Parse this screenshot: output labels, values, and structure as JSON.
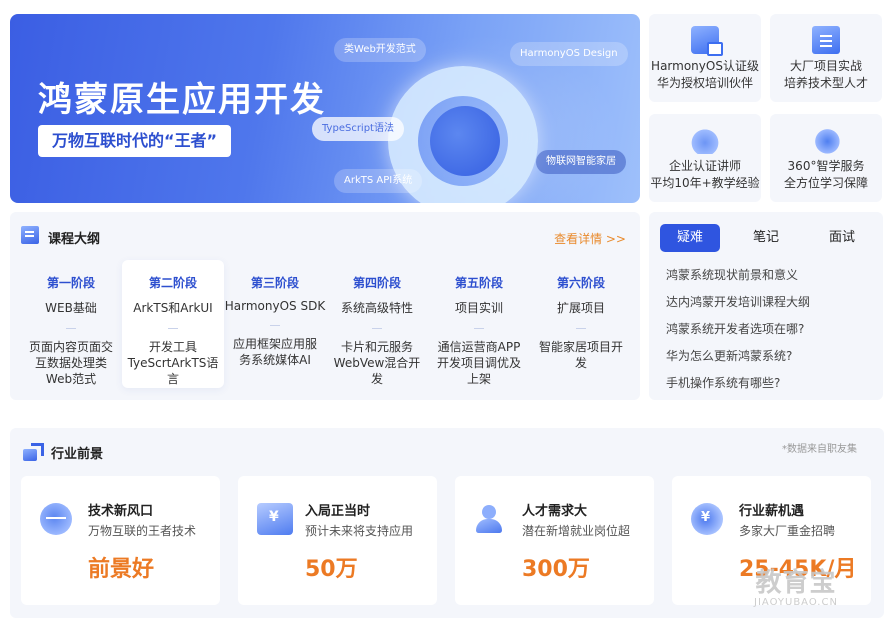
{
  "banner": {
    "title": "鸿蒙原生应用开发",
    "subtitle": "万物互联时代的“王者”",
    "tags": [
      "类Web开发范式",
      "HarmonyOS Design",
      "TypeScript语法",
      "ArkTS API系统",
      "物联网智能家居"
    ]
  },
  "features": [
    {
      "icon": "certificate-icon",
      "line1": "HarmonyOS认证级",
      "line2": "华为授权培训伙伴"
    },
    {
      "icon": "project-folder-icon",
      "line1": "大厂项目实战",
      "line2": "培养技术型人才"
    },
    {
      "icon": "cloud-teacher-icon",
      "line1": "企业认证讲师",
      "line2": "平均10年+教学经验"
    },
    {
      "icon": "medal-service-icon",
      "line1": "360°智学服务",
      "line2": "全方位学习保障"
    }
  ],
  "outline": {
    "title": "课程大纲",
    "more": "查看详情 >>",
    "stages": [
      {
        "name": "第一阶段",
        "topic": "WEB基础",
        "desc": "页面内容页面交互数据处理类Web范式"
      },
      {
        "name": "第二阶段",
        "topic": "ArkTS和ArkUI",
        "desc": "开发工具TyeScrtArkTS语言"
      },
      {
        "name": "第三阶段",
        "topic": "HarmonyOS SDK",
        "desc": "应用框架应用服务系统媒体AI"
      },
      {
        "name": "第四阶段",
        "topic": "系统高级特性",
        "desc": "卡片和元服务WebVew混合开发"
      },
      {
        "name": "第五阶段",
        "topic": "项目实训",
        "desc": "通信运营商APP开发项目调优及上架"
      },
      {
        "name": "第六阶段",
        "topic": "扩展项目",
        "desc": "智能家居项目开发"
      }
    ]
  },
  "faq": {
    "tabs": [
      "疑难",
      "笔记",
      "面试"
    ],
    "items": [
      "鸿蒙系统现状前景和意义",
      "达内鸿蒙开发培训课程大纲",
      "鸿蒙系统开发者选项在哪?",
      "华为怎么更新鸿蒙系统?",
      "手机操作系统有哪些?"
    ]
  },
  "industry": {
    "title": "行业前景",
    "note": "*数据来自职友集",
    "cards": [
      {
        "icon": "globe-icon",
        "title": "技术新风口",
        "sub": "万物互联的王者技术",
        "value": "前景好"
      },
      {
        "icon": "money-icon",
        "title": "入局正当时",
        "sub": "预计未来将支持应用",
        "value": "50万"
      },
      {
        "icon": "user-plus-icon",
        "title": "人才需求大",
        "sub": "潜在新增就业岗位超",
        "value": "300万"
      },
      {
        "icon": "salary-growth-icon",
        "title": "行业薪机遇",
        "sub": "多家大厂重金招聘",
        "value": "25-45K/月"
      }
    ]
  },
  "watermark": {
    "cn": "教育宝",
    "en": "JIAOYUBAO.CN"
  },
  "colors": {
    "brand_blue": "#2f55e0",
    "accent_orange": "#ec7a24",
    "panel_bg": "#f4f6fb"
  }
}
